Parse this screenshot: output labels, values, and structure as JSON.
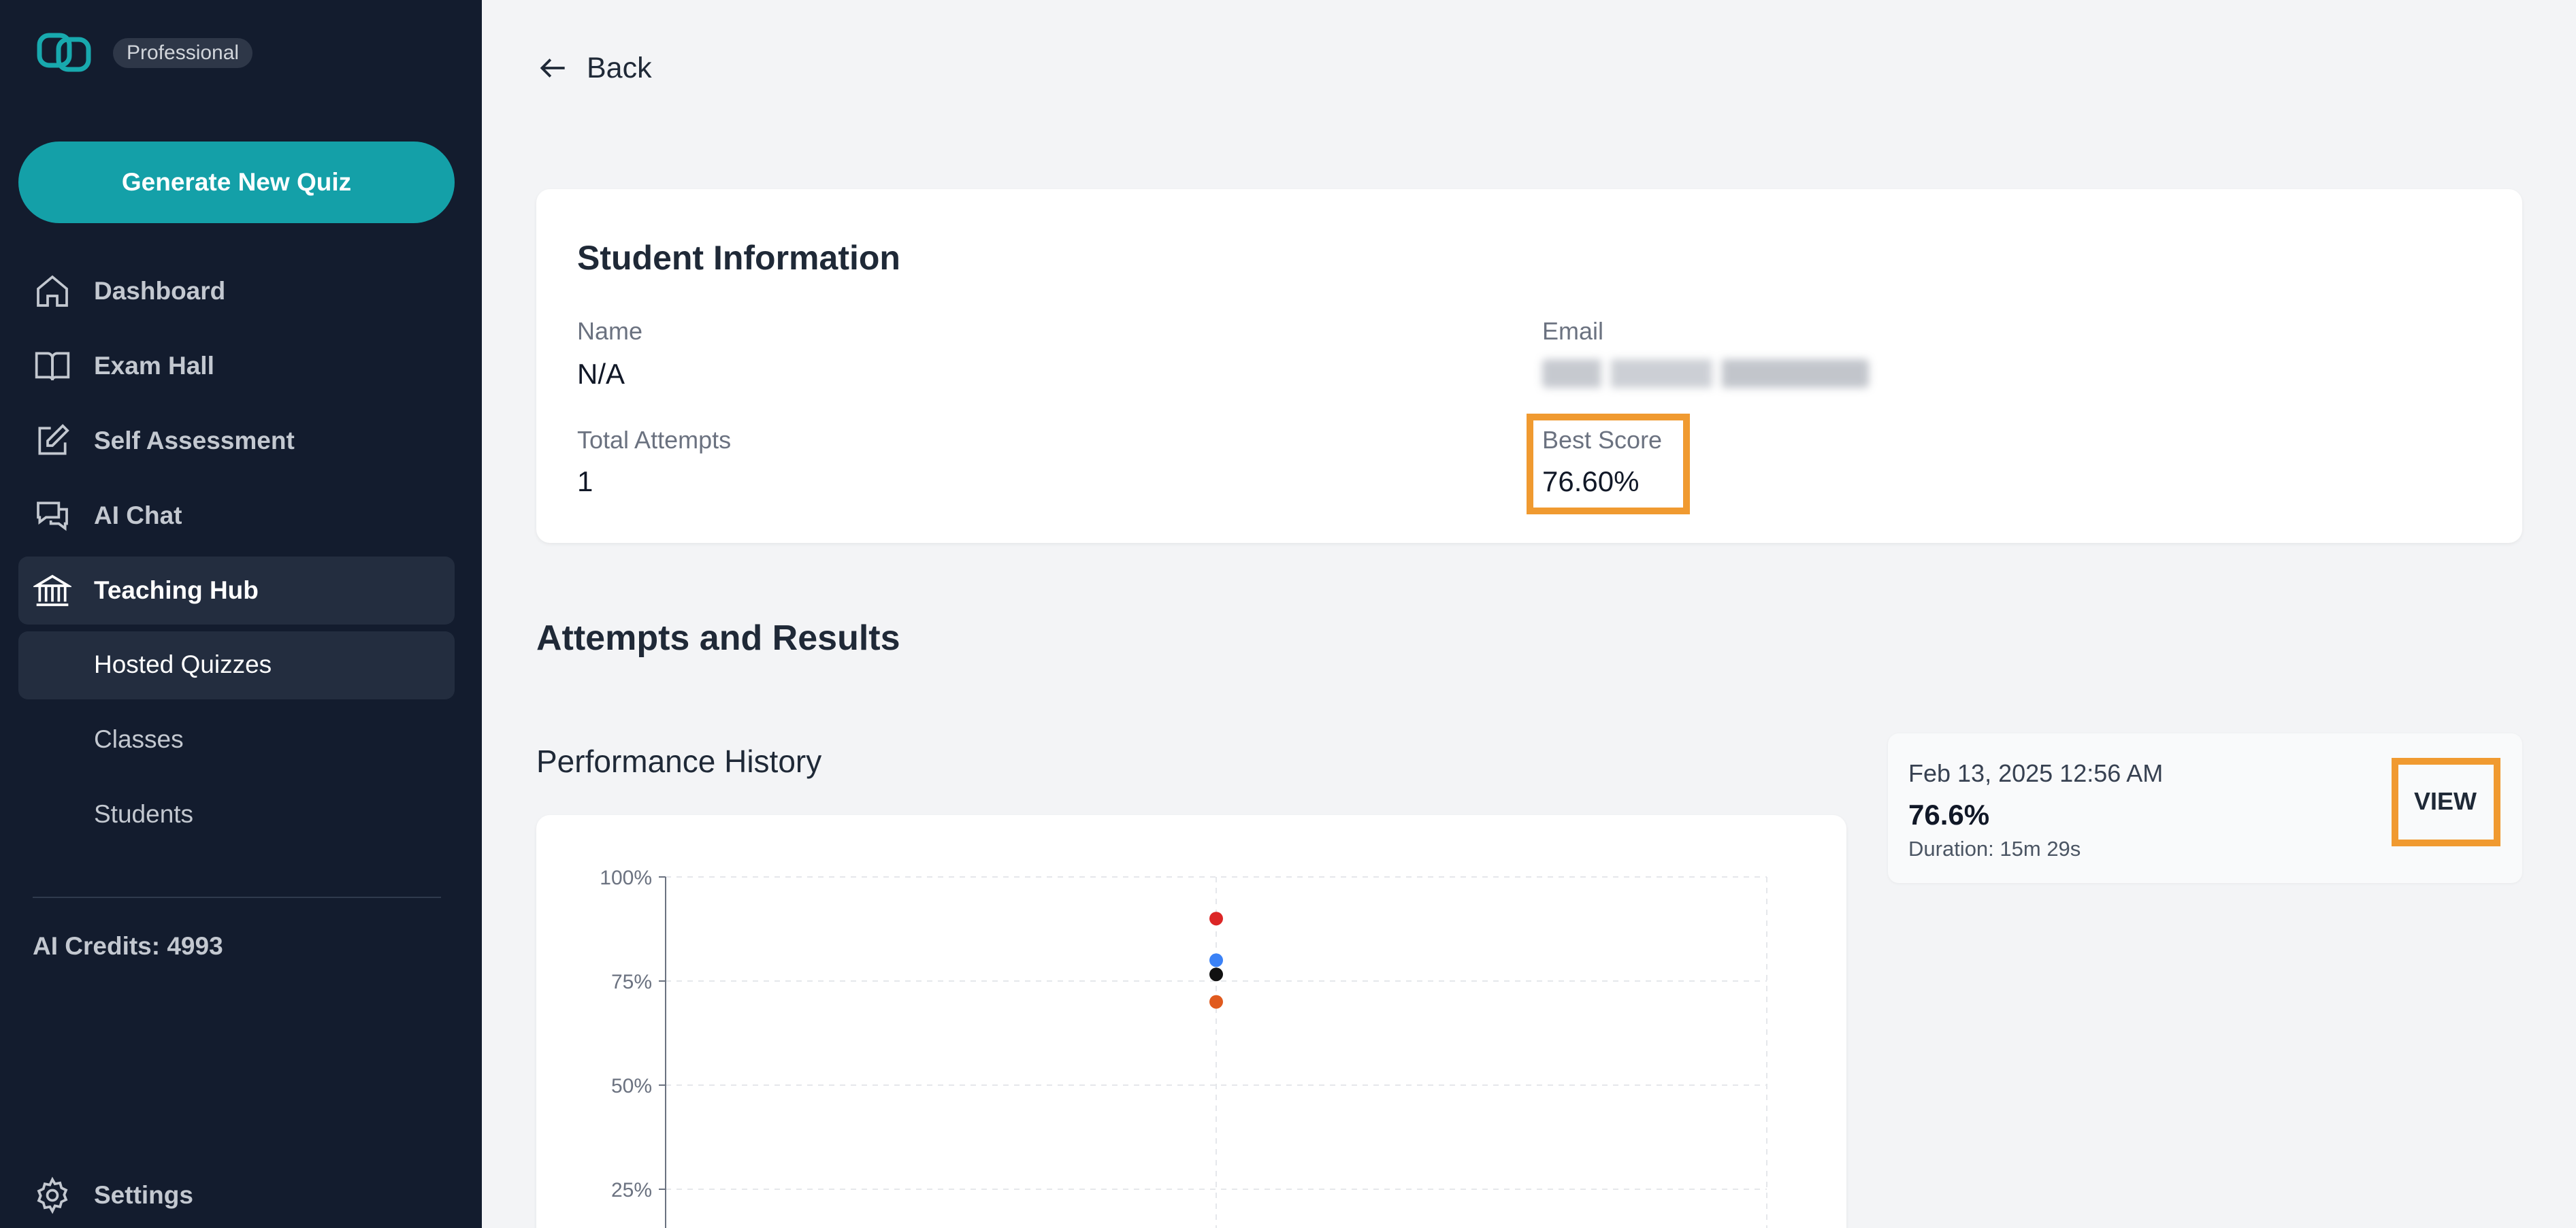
{
  "sidebar": {
    "plan": "Professional",
    "generate_label": "Generate New Quiz",
    "nav": [
      {
        "label": "Dashboard",
        "icon": "home-icon"
      },
      {
        "label": "Exam Hall",
        "icon": "book-icon"
      },
      {
        "label": "Self Assessment",
        "icon": "edit-icon"
      },
      {
        "label": "AI Chat",
        "icon": "chat-icon"
      },
      {
        "label": "Teaching Hub",
        "icon": "institution-icon"
      }
    ],
    "sub_nav": [
      {
        "label": "Hosted Quizzes"
      },
      {
        "label": "Classes"
      },
      {
        "label": "Students"
      }
    ],
    "credits": "AI Credits: 4993",
    "settings_label": "Settings"
  },
  "main": {
    "back_label": "Back",
    "student_info": {
      "title": "Student Information",
      "name_label": "Name",
      "name_value": "N/A",
      "email_label": "Email",
      "attempts_label": "Total Attempts",
      "attempts_value": "1",
      "best_label": "Best Score",
      "best_value": "76.60%"
    },
    "attempts_title": "Attempts and Results",
    "history_title": "Performance History",
    "attempt": {
      "date": "Feb 13, 2025 12:56 AM",
      "score": "76.6%",
      "duration": "Duration: 15m 29s",
      "view_label": "VIEW"
    }
  },
  "colors": {
    "sidebar_bg": "#131c2e",
    "accent": "#14a0a8",
    "highlight": "#f09a30"
  },
  "chart_data": {
    "type": "scatter",
    "y_ticks": [
      "100%",
      "75%",
      "50%",
      "25%"
    ],
    "ylim": [
      0,
      100
    ],
    "grid": true,
    "x": [
      1
    ],
    "series": [
      {
        "color": "#dc2626",
        "values": [
          90
        ]
      },
      {
        "color": "#3b82f6",
        "values": [
          80
        ]
      },
      {
        "color": "#111111",
        "values": [
          76.6
        ]
      },
      {
        "color": "#e05a1e",
        "values": [
          70
        ]
      }
    ]
  }
}
